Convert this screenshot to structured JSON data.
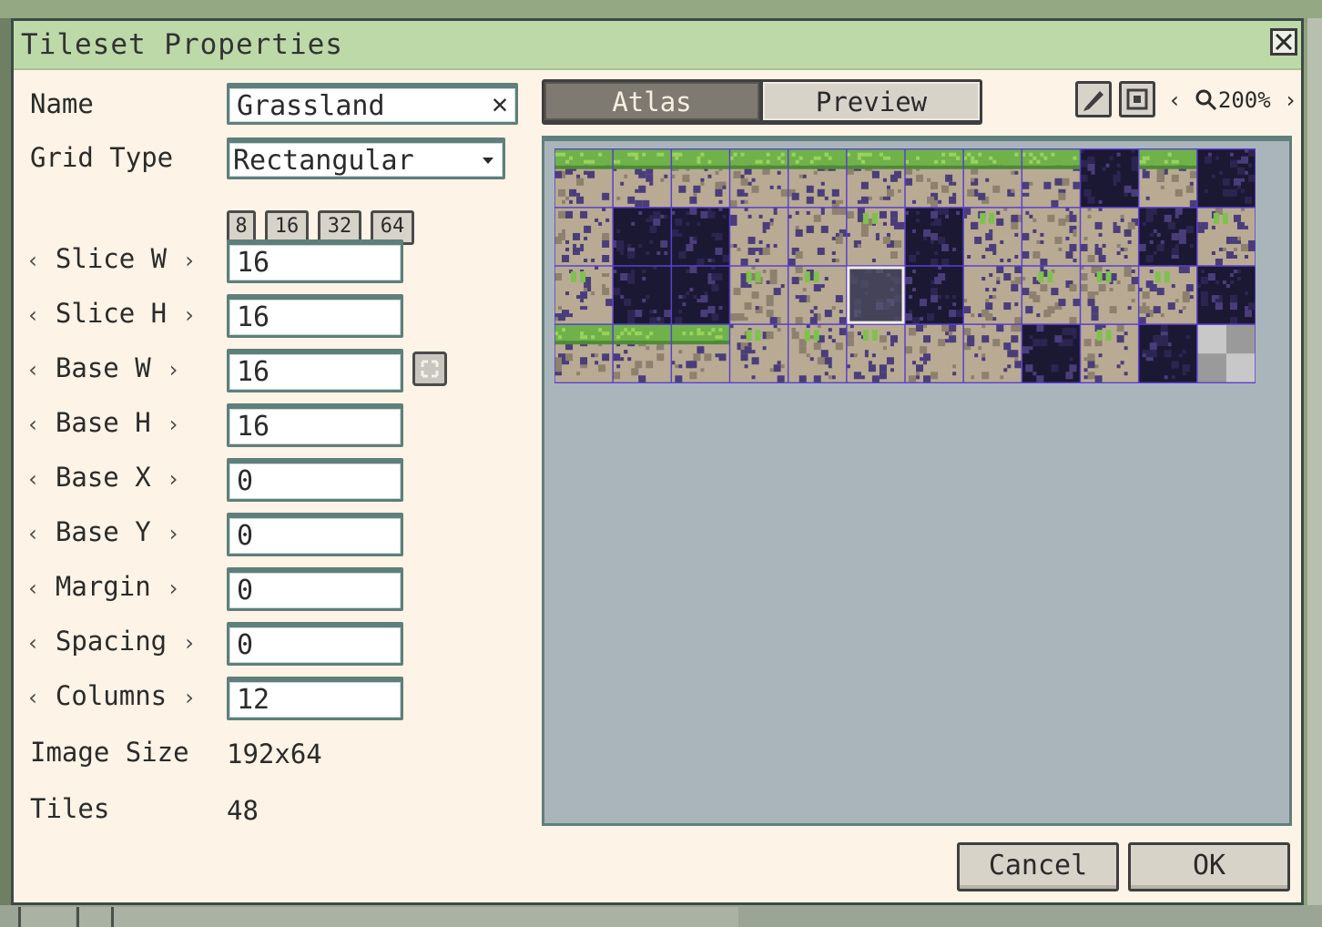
{
  "window": {
    "title": "Tileset Properties"
  },
  "form": {
    "name_label": "Name",
    "name_value": "Grassland",
    "grid_type_label": "Grid Type",
    "grid_type_value": "Rectangular",
    "grid_presets": [
      "8",
      "16",
      "32",
      "64"
    ],
    "fields": [
      {
        "label": "Slice W",
        "value": "16"
      },
      {
        "label": "Slice H",
        "value": "16"
      },
      {
        "label": "Base W",
        "value": "16"
      },
      {
        "label": "Base H",
        "value": "16"
      },
      {
        "label": "Base X",
        "value": "0"
      },
      {
        "label": "Base Y",
        "value": "0"
      },
      {
        "label": "Margin",
        "value": "0"
      },
      {
        "label": "Spacing",
        "value": "0"
      },
      {
        "label": "Columns",
        "value": "12"
      }
    ],
    "image_size_label": "Image Size",
    "image_size_value": "192x64",
    "tiles_label": "Tiles",
    "tiles_value": "48"
  },
  "atlas_view": {
    "tabs": [
      "Atlas",
      "Preview"
    ],
    "active_tab": "Atlas",
    "zoom": "200%",
    "tileset": {
      "columns": 12,
      "rows": 4,
      "selected_tile": {
        "col": 5,
        "row": 2
      }
    }
  },
  "icons": {
    "close": "close-icon",
    "clear": "clear-icon",
    "dropdown": "chevron-down-icon",
    "link": "link-icon",
    "edit": "pencil-icon",
    "fit": "fit-to-view-icon",
    "zoom": "magnifier-icon"
  },
  "colors": {
    "titlebar": "#bdd9a8",
    "dialog_bg": "#fdf3e6",
    "field_border": "#5f7f7b",
    "atlas_bg": "#a9b5bb",
    "grid_line": "#5a3fd0",
    "grass": "#6fb24a",
    "dirt": "#b9ab93",
    "rock": "#4b3d7a",
    "void": "#1b1833"
  },
  "buttons": {
    "cancel": "Cancel",
    "ok": "OK"
  },
  "glyphs": {
    "left_arrow": "‹",
    "right_arrow": "›"
  }
}
